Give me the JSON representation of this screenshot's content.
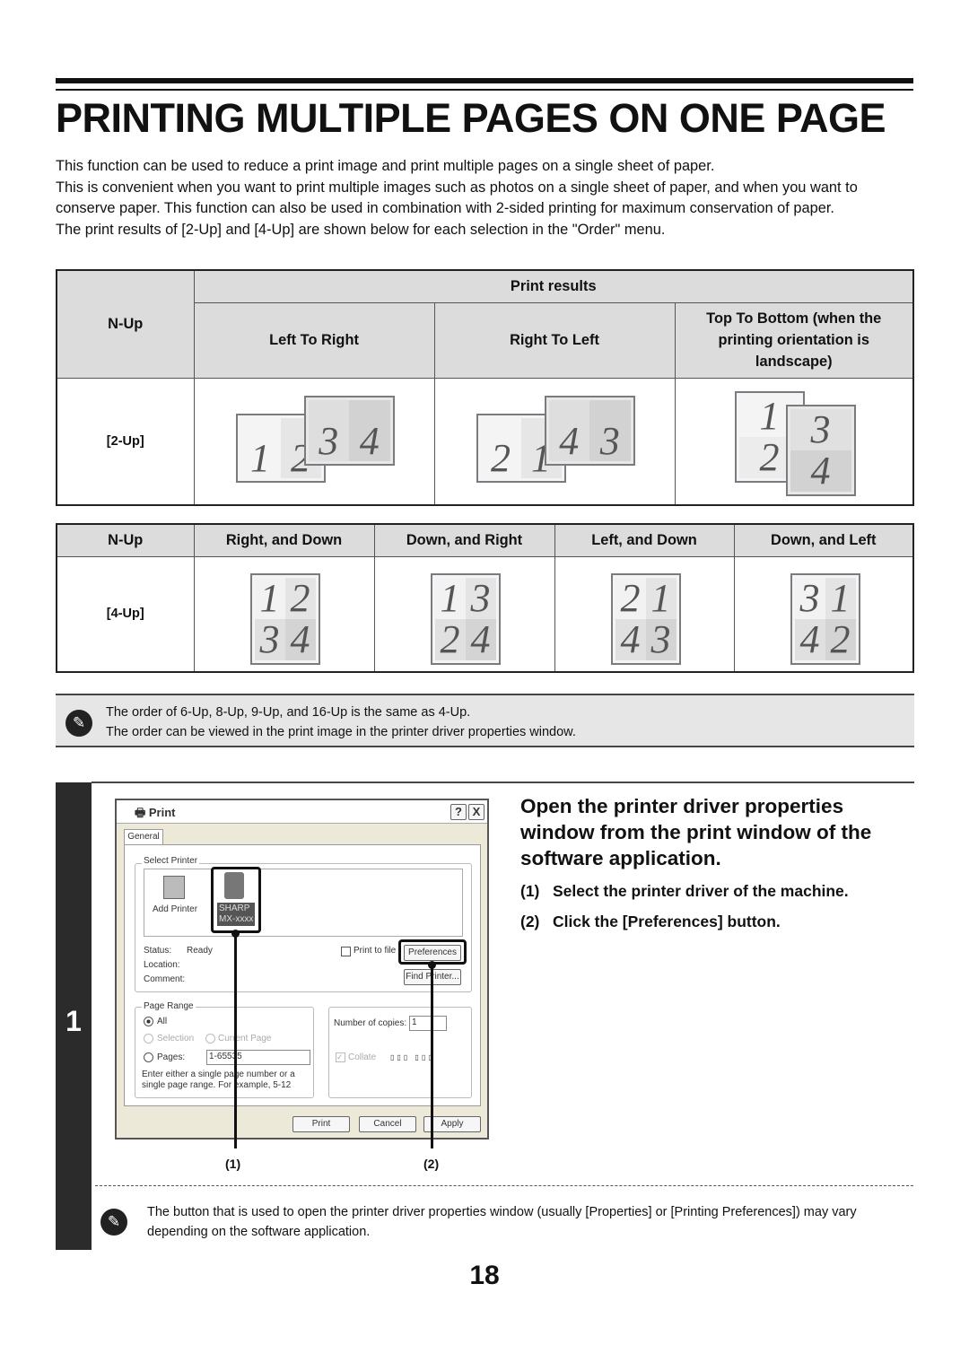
{
  "title": "PRINTING MULTIPLE PAGES ON ONE PAGE",
  "intro": [
    "This function can be used to reduce a print image and print multiple pages on a single sheet of paper.",
    "This is convenient when you want to print multiple images such as photos on a single sheet of paper, and when you want to conserve paper. This function can also be used in combination with 2-sided printing for maximum conservation of paper.",
    "The print results of [2-Up] and [4-Up] are shown below for each selection in the \"Order\" menu."
  ],
  "table1": {
    "nup_header": "N-Up",
    "group_header": "Print results",
    "columns": [
      "Left To Right",
      "Right To Left",
      "Top To Bottom (when the printing orientation is landscape)"
    ],
    "row_label": "[2-Up]",
    "thumbs": [
      {
        "layout": "landscape",
        "sheets": [
          [
            "1",
            "2"
          ],
          [
            "3",
            "4"
          ]
        ]
      },
      {
        "layout": "landscape",
        "sheets": [
          [
            "2",
            "1"
          ],
          [
            "4",
            "3"
          ]
        ]
      },
      {
        "layout": "portrait",
        "sheets": [
          [
            "1",
            "2"
          ],
          [
            "3",
            "4"
          ]
        ]
      }
    ]
  },
  "table2": {
    "nup_header": "N-Up",
    "columns": [
      "Right, and Down",
      "Down, and Right",
      "Left, and Down",
      "Down, and Left"
    ],
    "row_label": "[4-Up]",
    "thumbs": [
      [
        "1",
        "2",
        "3",
        "4"
      ],
      [
        "1",
        "3",
        "2",
        "4"
      ],
      [
        "2",
        "1",
        "4",
        "3"
      ],
      [
        "3",
        "1",
        "4",
        "2"
      ]
    ]
  },
  "note1": {
    "icon": "pencil-note-icon",
    "lines": [
      "The order of 6-Up, 8-Up, 9-Up, and 16-Up is the same as 4-Up.",
      "The order can be viewed in the print image in the printer driver properties window."
    ]
  },
  "step": {
    "number": "1",
    "heading": "Open the printer driver properties window from the print window of the software application.",
    "items": [
      {
        "num": "(1)",
        "text": "Select the printer driver of the machine."
      },
      {
        "num": "(2)",
        "text": "Click the [Preferences] button."
      }
    ]
  },
  "dialog": {
    "title": "Print",
    "help": "?",
    "close": "X",
    "tab": "General",
    "select_printer": "Select Printer",
    "add_printer": "Add Printer",
    "printer_name": [
      "SHARP",
      "MX-xxxx"
    ],
    "status_label": "Status:",
    "status_value": "Ready",
    "location_label": "Location:",
    "comment_label": "Comment:",
    "print_to_file": "Print to file",
    "preferences": "Preferences",
    "find_printer": "Find Printer...",
    "page_range": "Page Range",
    "all": "All",
    "selection": "Selection",
    "current_page": "Current Page",
    "pages": "Pages:",
    "pages_value": "1-65535",
    "hint": "Enter either a single page number or a single page range.  For example, 5-12",
    "copies_label": "Number of copies:",
    "copies_value": "1",
    "collate": "Collate",
    "print": "Print",
    "cancel": "Cancel",
    "apply": "Apply"
  },
  "callouts": [
    "(1)",
    "(2)"
  ],
  "note2": {
    "icon": "pencil-note-icon",
    "text": "The button that is used to open the printer driver properties window (usually [Properties] or [Printing Preferences]) may vary depending on the software application."
  },
  "page_number": "18"
}
